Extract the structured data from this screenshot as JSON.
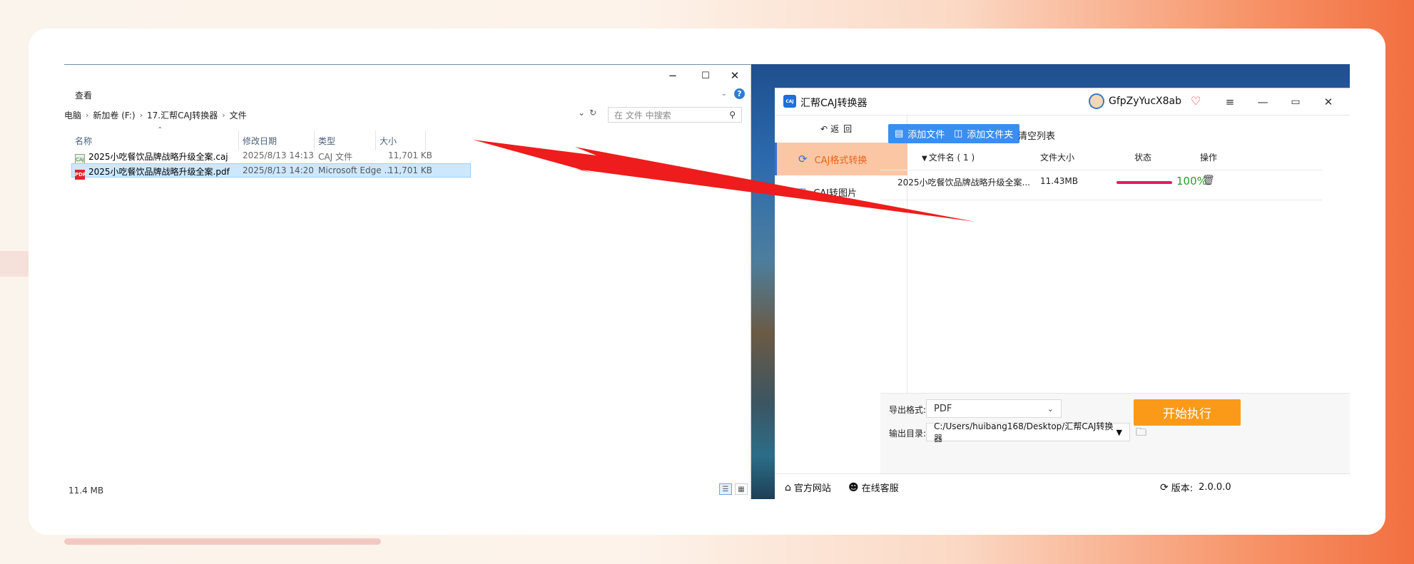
{
  "explorer": {
    "controls": {
      "minimize": "−",
      "maximize": "☐",
      "close": "✕"
    },
    "menu_view": "查看",
    "breadcrumb": [
      "电脑",
      "新加卷 (F:)",
      "17.汇帮CAJ转换器",
      "文件"
    ],
    "search_placeholder": "在 文件 中搜索",
    "columns": [
      "名称",
      "修改日期",
      "类型",
      "大小"
    ],
    "files": [
      {
        "name": "2025小吃餐饮品牌战略升级全案.caj",
        "date": "2025/8/13 14:13",
        "type": "CAJ 文件",
        "size": "11,701 KB",
        "icon": "caj-file-icon",
        "selected": false
      },
      {
        "name": "2025小吃餐饮品牌战略升级全案.pdf",
        "date": "2025/8/13 14:20",
        "type": "Microsoft Edge ...",
        "size": "11,701 KB",
        "icon": "pdf-file-icon",
        "selected": true
      }
    ],
    "status_size": "11.4 MB"
  },
  "app": {
    "title": "汇帮CAJ转换器",
    "logo_text": "CAJ",
    "username": "GfpZyYucX8ab",
    "back": "返回",
    "nav": [
      {
        "label": "CAJ格式转换",
        "active": true
      },
      {
        "label": "CAJ转图片",
        "active": false
      }
    ],
    "toolbar": {
      "add_file": "添加文件",
      "add_folder": "添加文件夹",
      "clear": "清空列表"
    },
    "table": {
      "headers": {
        "name": "文件名 ( 1 )",
        "size": "文件大小",
        "status": "状态",
        "action": "操作"
      },
      "rows": [
        {
          "name": "2025小吃餐饮品牌战略升级全案...",
          "size": "11.43MB",
          "progress": 1.0,
          "progress_text": "100%"
        }
      ]
    },
    "export_label": "导出格式:",
    "export_value": "PDF",
    "output_label": "输出目录:",
    "output_value": "C:/Users/huibang168/Desktop/汇帮CAJ转换器",
    "start": "开始执行",
    "footer": {
      "website": "官方网站",
      "support": "在线客服",
      "version_label": "版本:",
      "version": "2.0.0.0"
    }
  },
  "colors": {
    "accent_orange": "#fb9a18",
    "button_blue": "#3a8ef0",
    "nav_active_bg": "#fbc6a3",
    "arrow_red": "#ee1c1c",
    "progress": "#e8195e",
    "percent_green": "#2a9d2a"
  }
}
